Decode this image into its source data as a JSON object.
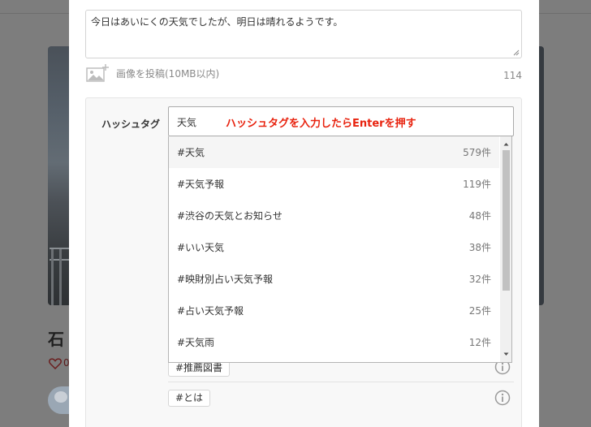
{
  "post": {
    "body_text": "今日はあいにくの天気でしたが、明日は晴れるようです。",
    "image_upload_label": "画像を投稿(10MB以内)",
    "char_count": "114"
  },
  "hashtag": {
    "label": "ハッシュタグ",
    "input_value": "天気",
    "hint": "ハッシュタグを入力したらEnterを押す",
    "hint_color": "#e8230f",
    "existing_tags": [
      "#推薦図書",
      "#とは"
    ]
  },
  "suggestions": [
    {
      "tag": "#天気",
      "count": "579件"
    },
    {
      "tag": "#天気予報",
      "count": "119件"
    },
    {
      "tag": "#渋谷の天気とお知らせ",
      "count": "48件"
    },
    {
      "tag": "#いい天気",
      "count": "38件"
    },
    {
      "tag": "#映財別占い天気予報",
      "count": "32件"
    },
    {
      "tag": "#占い天気予報",
      "count": "25件"
    },
    {
      "tag": "#天気雨",
      "count": "12件"
    }
  ],
  "background": {
    "title_fragment": "石",
    "like_count_fragment": "0"
  }
}
